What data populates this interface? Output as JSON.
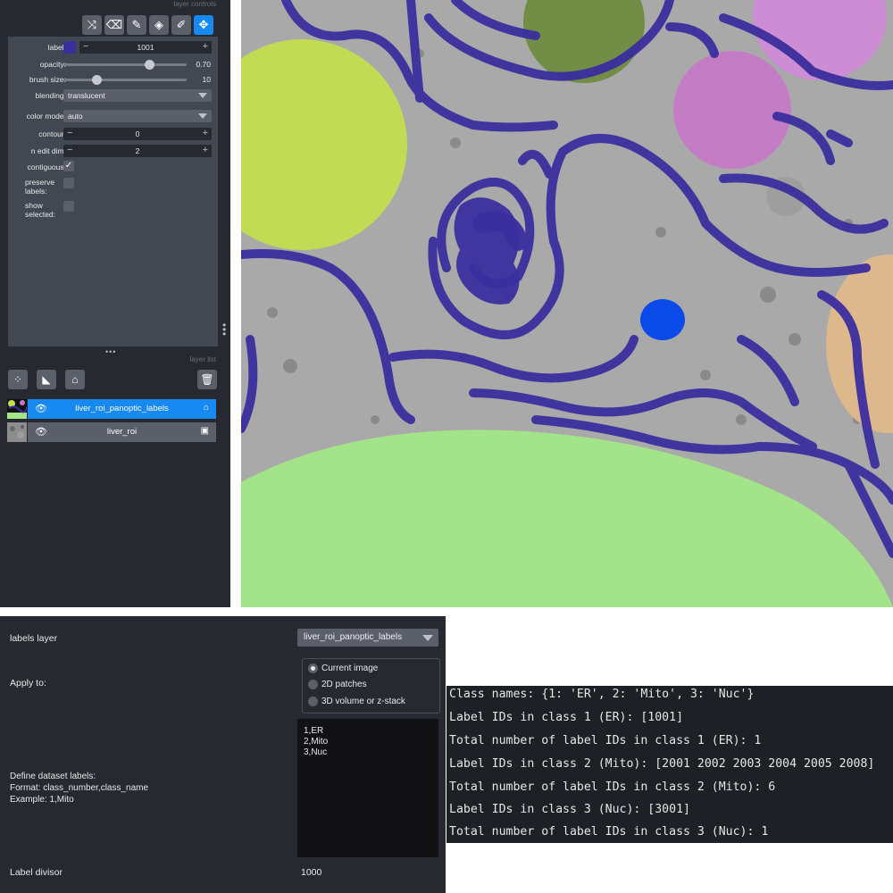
{
  "dock": {
    "controls_header": "layer controls",
    "list_header": "layer list"
  },
  "tools": [
    {
      "name": "shuffle-colors-icon",
      "glyph": "⤨"
    },
    {
      "name": "eraser-icon",
      "glyph": "⌫"
    },
    {
      "name": "paintbrush-icon",
      "glyph": "✎"
    },
    {
      "name": "fill-bucket-icon",
      "glyph": "◈"
    },
    {
      "name": "color-picker-icon",
      "glyph": "✐"
    },
    {
      "name": "pan-zoom-icon",
      "glyph": "✥",
      "active": true
    }
  ],
  "controls": {
    "label": {
      "label": "label:",
      "value": "1001",
      "swatch_color": "#3b2e9e"
    },
    "opacity": {
      "label": "opacity:",
      "value": "0.70",
      "fraction": 0.7
    },
    "brush_size": {
      "label": "brush size:",
      "value": "10",
      "fraction": 0.27
    },
    "blending": {
      "label": "blending:",
      "value": "translucent"
    },
    "color_mode": {
      "label": "color mode:",
      "value": "auto"
    },
    "contour": {
      "label": "contour:",
      "value": "0"
    },
    "n_edit_dim": {
      "label": "n edit dim:",
      "value": "2"
    },
    "contiguous": {
      "label": "contiguous:",
      "checked": true
    },
    "preserve_labels": {
      "label1": "preserve",
      "label2": "labels:",
      "checked": false
    },
    "show_selected": {
      "label1": "show",
      "label2": "selected:",
      "checked": false
    }
  },
  "layer_buttons": [
    "new-points-layer-icon",
    "new-shapes-layer-icon",
    "new-labels-layer-icon",
    "delete-layer-icon"
  ],
  "layers": [
    {
      "name": "liver_roi_panoptic_labels",
      "selected": true,
      "type_icon": "labels-icon"
    },
    {
      "name": "liver_roi",
      "selected": false,
      "type_icon": "image-icon"
    }
  ],
  "plugin": {
    "labels_layer_label": "labels layer",
    "labels_layer_value": "liver_roi_panoptic_labels",
    "apply_to_label": "Apply to:",
    "apply_options": [
      {
        "label": "Current image",
        "checked": true
      },
      {
        "label": "2D patches",
        "checked": false
      },
      {
        "label": "3D volume or z-stack",
        "checked": false
      }
    ],
    "define_title": "Define dataset labels:",
    "define_format": "Format: class_number,class_name",
    "define_example": "Example: 1,Mito",
    "dataset_labels": [
      "1,ER",
      "2,Mito",
      "3,Nuc"
    ],
    "divisor_label": "Label divisor",
    "divisor_value": "1000"
  },
  "console_lines": [
    "Class names: {1: 'ER', 2: 'Mito', 3: 'Nuc'}",
    "Label IDs in class 1 (ER): [1001]",
    "Total number of label IDs in class 1 (ER): 1",
    "Label IDs in class 2 (Mito): [2001 2002 2003 2004 2005 2008]",
    "Total number of label IDs in class 2 (Mito): 6",
    "Label IDs in class 3 (Nuc): [3001]",
    "Total number of label IDs in class 3 (Nuc): 1"
  ],
  "colors": {
    "er": "#3b2e9e",
    "nuc": "#a3e38a",
    "mito_yellow": "#c3e04a",
    "mito_olive": "#6b8a3a",
    "mito_pink": "#c678c6",
    "mito_violet": "#d08ad8",
    "mito_tan": "#e3b98a",
    "selected_blue": "#0a4ae8"
  }
}
